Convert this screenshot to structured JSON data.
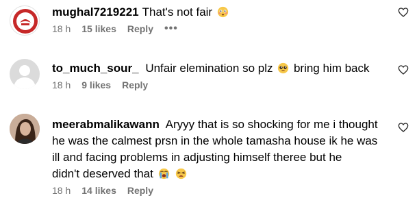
{
  "comments": [
    {
      "username": "mughal7219221",
      "text": "That's not fair",
      "time": "18 h",
      "likes": "15 likes",
      "reply": "Reply",
      "more": "•••"
    },
    {
      "username": "to_much_sour_",
      "text_a": "Unfair elemination so plz",
      "text_b": "bring him back",
      "time": "18 h",
      "likes": "9 likes",
      "reply": "Reply"
    },
    {
      "username": "meerabmalikawann",
      "line1": "Aryyy that is so shocking for me i thought",
      "line2": "he was the calmest prsn in the whole tamasha house ik he was",
      "line3": "ill and facing problems in adjusting himself theree but he",
      "line4": "didn't deserved that",
      "time": "18 h",
      "likes": "14 likes",
      "reply": "Reply"
    }
  ],
  "icons": {
    "heart": "heart-outline-icon",
    "avatar1": "red-emblem-avatar",
    "avatar2": "default-user-avatar",
    "avatar3": "photo-avatar"
  },
  "colors": {
    "meta": "#737373",
    "heart": "#262626"
  }
}
